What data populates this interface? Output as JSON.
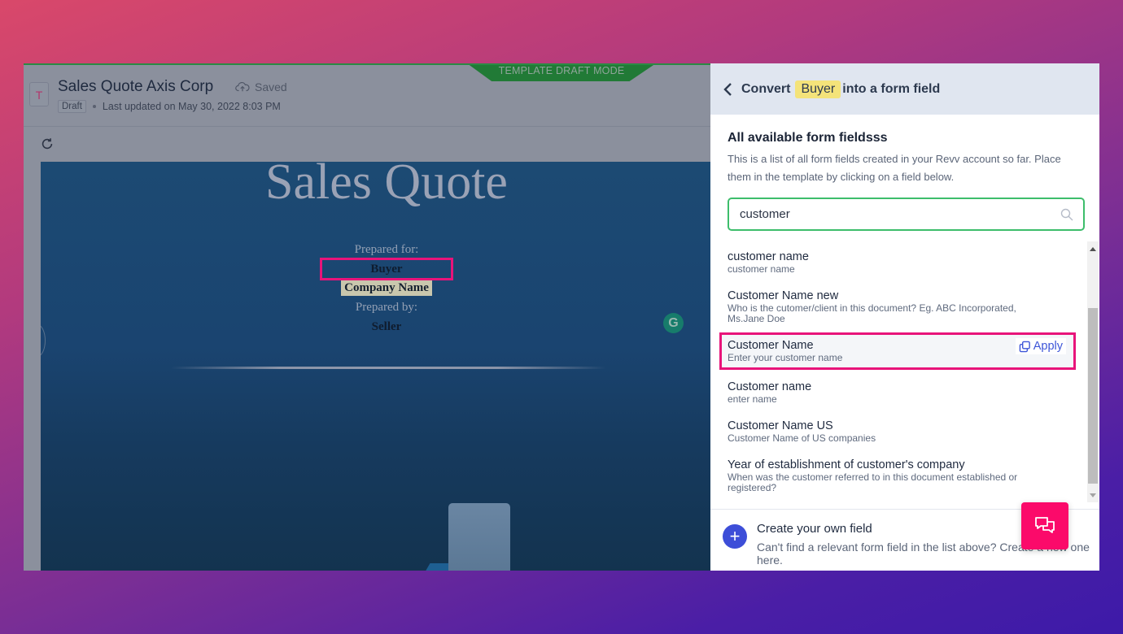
{
  "editor": {
    "doc_icon_letter": "T",
    "doc_title": "Sales Quote Axis Corp",
    "saved_label": "Saved",
    "status_badge": "Draft",
    "last_updated": "Last updated on May 30, 2022 8:03 PM",
    "mode_banner": "TEMPLATE DRAFT MODE"
  },
  "document": {
    "title": "Sales Quote",
    "prepared_for_label": "Prepared for:",
    "buyer": "Buyer",
    "company_name": "Company Name",
    "prepared_by_label": "Prepared by:",
    "seller": "Seller",
    "grammarly_letter": "G"
  },
  "panel": {
    "header_prefix": "Convert",
    "header_highlight": "Buyer",
    "header_suffix": "into a form field",
    "section_title": "All available form fieldsss",
    "section_desc": "This is a list of all form fields created in your Revv account so far. Place them in the template by clicking on a field below.",
    "search_value": "customer",
    "fields": [
      {
        "name": "customer name",
        "desc": "customer name"
      },
      {
        "name": "Customer Name new",
        "desc": "Who is the cutomer/client in this document? Eg. ABC Incorporated, Ms.Jane Doe"
      },
      {
        "name": "Customer Name",
        "desc": "Enter your customer name",
        "selected": true
      },
      {
        "name": "Customer name",
        "desc": "enter name"
      },
      {
        "name": "Customer Name US",
        "desc": "Customer Name of US companies"
      },
      {
        "name": "Year of establishment of customer's company",
        "desc": "When was the customer referred to in this document established or registered?"
      }
    ],
    "apply_label": "Apply",
    "create_title": "Create your own field",
    "create_desc": "Can't find a relevant form field in the list above? Create a new one here."
  },
  "colors": {
    "highlight_border": "#e8147a",
    "accent_blue": "#3d55d8",
    "search_border": "#3dbd6b",
    "chat_fab": "#fb0a6a"
  }
}
